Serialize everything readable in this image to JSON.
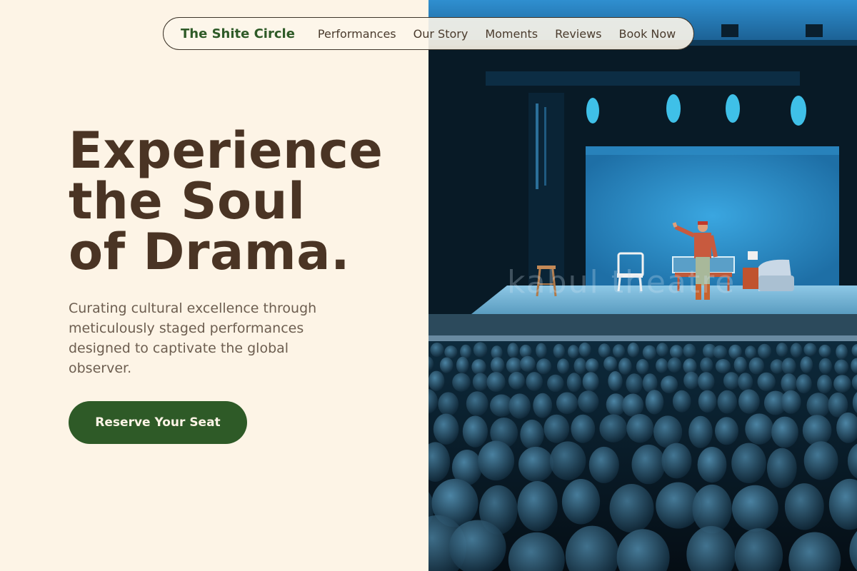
{
  "nav": {
    "brand": "The Shite Circle",
    "links": [
      "Performances",
      "Our Story",
      "Moments",
      "Reviews",
      "Book Now"
    ]
  },
  "hero": {
    "headline_lines": [
      "Experience",
      "the Soul",
      "of Drama."
    ],
    "subtext": "Curating cultural excellence through meticulously staged performances designed to captivate the global observer.",
    "cta_label": "Reserve Your Seat"
  },
  "image": {
    "watermark": "kabul theatre"
  },
  "colors": {
    "background": "#fdf4e6",
    "brand_green": "#2e5a27",
    "headline_brown": "#4a3424",
    "body_text": "#6d5e50"
  }
}
